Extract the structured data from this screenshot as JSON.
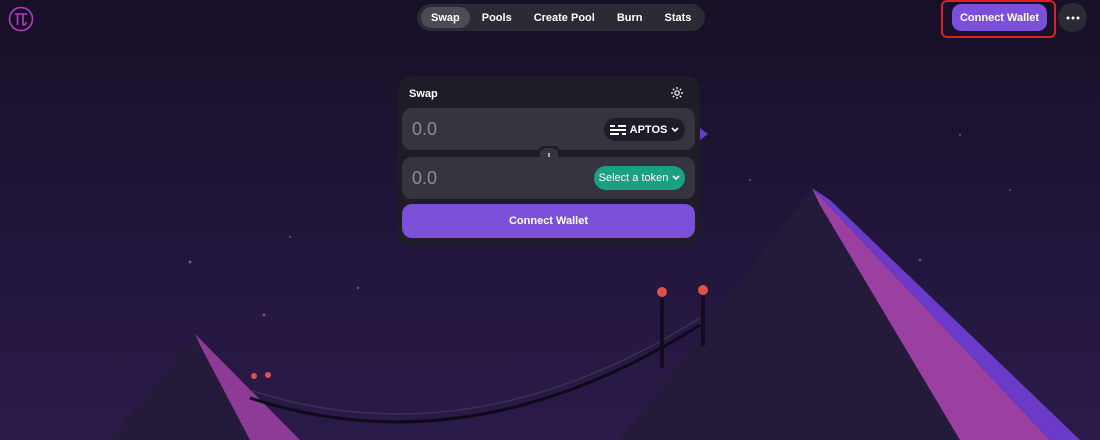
{
  "nav": {
    "items": [
      {
        "label": "Swap",
        "active": true
      },
      {
        "label": "Pools",
        "active": false
      },
      {
        "label": "Create Pool",
        "active": false
      },
      {
        "label": "Burn",
        "active": false
      },
      {
        "label": "Stats",
        "active": false
      }
    ]
  },
  "header": {
    "connect_label": "Connect Wallet",
    "more_icon": "ellipsis-icon"
  },
  "swap": {
    "title": "Swap",
    "from": {
      "placeholder": "0.0",
      "token": "APTOS"
    },
    "to": {
      "placeholder": "0.0",
      "token_button": "Select a token"
    },
    "connect_label": "Connect Wallet"
  },
  "colors": {
    "accent": "#7b4fd8",
    "highlight": "#e01e1e",
    "select_token": "#1aa082",
    "card": "#1e1d27",
    "field": "#35343f"
  }
}
